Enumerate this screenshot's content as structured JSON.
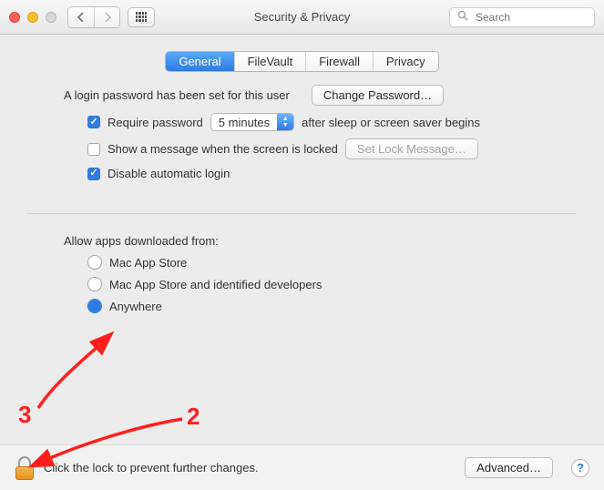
{
  "window_title": "Security & Privacy",
  "search": {
    "placeholder": "Search"
  },
  "tabs": [
    {
      "label": "General",
      "active": true
    },
    {
      "label": "FileVault",
      "active": false
    },
    {
      "label": "Firewall",
      "active": false
    },
    {
      "label": "Privacy",
      "active": false
    }
  ],
  "login_password": {
    "message": "A login password has been set for this user",
    "change_button": "Change Password…",
    "require_prefix": "Require password",
    "require_delay": "5 minutes",
    "require_suffix": "after sleep or screen saver begins",
    "require_checked": true,
    "show_message_label": "Show a message when the screen is locked",
    "show_message_checked": false,
    "set_lock_message_button": "Set Lock Message…",
    "disable_auto_login_label": "Disable automatic login",
    "disable_auto_login_checked": true
  },
  "allow_apps": {
    "heading": "Allow apps downloaded from:",
    "options": [
      {
        "label": "Mac App Store",
        "selected": false
      },
      {
        "label": "Mac App Store and identified developers",
        "selected": false
      },
      {
        "label": "Anywhere",
        "selected": true
      }
    ]
  },
  "footer": {
    "lock_text": "Click the lock to prevent further changes.",
    "advanced_button": "Advanced…"
  },
  "annotations": {
    "n2": "2",
    "n3": "3"
  }
}
